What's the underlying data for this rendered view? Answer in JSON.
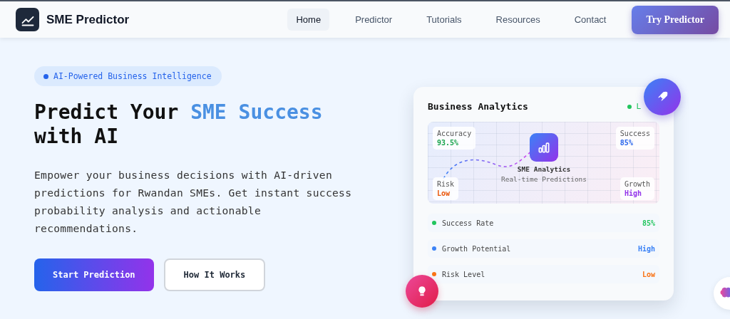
{
  "nav": {
    "brand": "SME Predictor",
    "links": [
      {
        "label": "Home",
        "selected": true
      },
      {
        "label": "Predictor",
        "selected": false
      },
      {
        "label": "Tutorials",
        "selected": false
      },
      {
        "label": "Resources",
        "selected": false
      },
      {
        "label": "Contact",
        "selected": false
      }
    ],
    "cta": "Try Predictor"
  },
  "hero": {
    "badge": "AI-Powered Business Intelligence",
    "title_start": "Predict Your ",
    "title_accent": "SME Success",
    "title_end": "with AI",
    "text": "Empower your business decisions with AI-driven predictions for Rwandan SMEs. Get instant success probability analysis and actionable recommendations.",
    "primary_button": "Start Prediction",
    "secondary_button": "How It Works"
  },
  "card": {
    "title": "Business Analytics",
    "status": "L",
    "center_title": "SME Analytics",
    "center_subtitle": "Real-time Predictions",
    "chips": [
      {
        "label": "Accuracy",
        "value": "93.5%",
        "color": "#16a34a"
      },
      {
        "label": "Success",
        "value": "85%",
        "color": "#2563eb"
      },
      {
        "label": "Risk",
        "value": "Low",
        "color": "#ea580c"
      },
      {
        "label": "Growth",
        "value": "High",
        "color": "#9333ea"
      }
    ],
    "stats": [
      {
        "label": "Success Rate",
        "value": "85%",
        "color": "#22c55e"
      },
      {
        "label": "Growth Potential",
        "value": "High",
        "color": "#3b82f6"
      },
      {
        "label": "Risk Level",
        "value": "Low",
        "color": "#f97316"
      }
    ]
  }
}
